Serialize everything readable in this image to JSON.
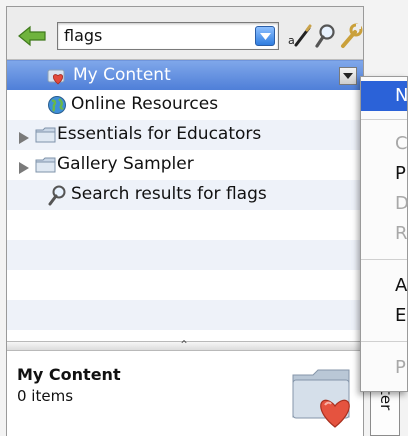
{
  "search": {
    "value": "flags"
  },
  "tree": {
    "items": [
      {
        "label": "My Content",
        "selected": true
      },
      {
        "label": "Online Resources"
      },
      {
        "label": "Essentials for Educators",
        "expandable": true
      },
      {
        "label": "Gallery Sampler",
        "expandable": true
      },
      {
        "label": "Search results for flags"
      }
    ]
  },
  "info": {
    "title": "My Content",
    "count": "0 items"
  },
  "side_tab": {
    "label": "ter"
  },
  "context_menu": {
    "items": [
      {
        "label": "N",
        "highlighted": true
      },
      {
        "label": "C",
        "disabled": true
      },
      {
        "label": "P"
      },
      {
        "label": "D",
        "disabled": true
      },
      {
        "label": "R",
        "disabled": true
      },
      {
        "label": "A"
      },
      {
        "label": "E"
      },
      {
        "label": "P",
        "disabled": true
      }
    ]
  },
  "colors": {
    "selection": "#5b86da",
    "menu_highlight": "#2b62d8"
  }
}
